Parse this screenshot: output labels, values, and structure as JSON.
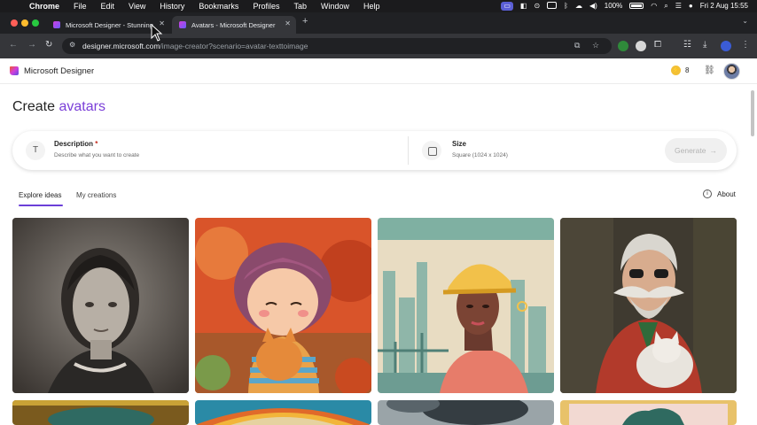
{
  "menubar": {
    "app_name": "Chrome",
    "menus": [
      "File",
      "Edit",
      "View",
      "History",
      "Bookmarks",
      "Profiles",
      "Tab",
      "Window",
      "Help"
    ],
    "battery": "100%",
    "datetime": "Fri 2 Aug  15:55"
  },
  "browser": {
    "tabs": [
      {
        "title": "Microsoft Designer - Stunning",
        "active": false
      },
      {
        "title": "Avatars - Microsoft Designer",
        "active": true
      }
    ],
    "url_domain": "designer.microsoft.com",
    "url_path": "/image-creator?scenario=avatar-texttoimage"
  },
  "app": {
    "name": "Microsoft Designer",
    "credits": "8",
    "title_prefix": "Create",
    "title_accent": "avatars",
    "description_label": "Description",
    "description_required": "*",
    "description_placeholder": "Describe what you want to create",
    "size_label": "Size",
    "size_value": "Square (1024 x 1024)",
    "generate_label": "Generate",
    "tabs": [
      "Explore ideas",
      "My creations"
    ],
    "active_tab": "Explore ideas",
    "about_label": "About"
  },
  "gallery": [
    {
      "subject": "vintage-woman-portrait"
    },
    {
      "subject": "cartoon-girl-with-cat"
    },
    {
      "subject": "construction-worker-illustration"
    },
    {
      "subject": "bearded-man-with-cat"
    }
  ],
  "colors": {
    "accent": "#7b3fd8",
    "menubar": "#1b1b1d",
    "toolbar": "#35363a"
  }
}
